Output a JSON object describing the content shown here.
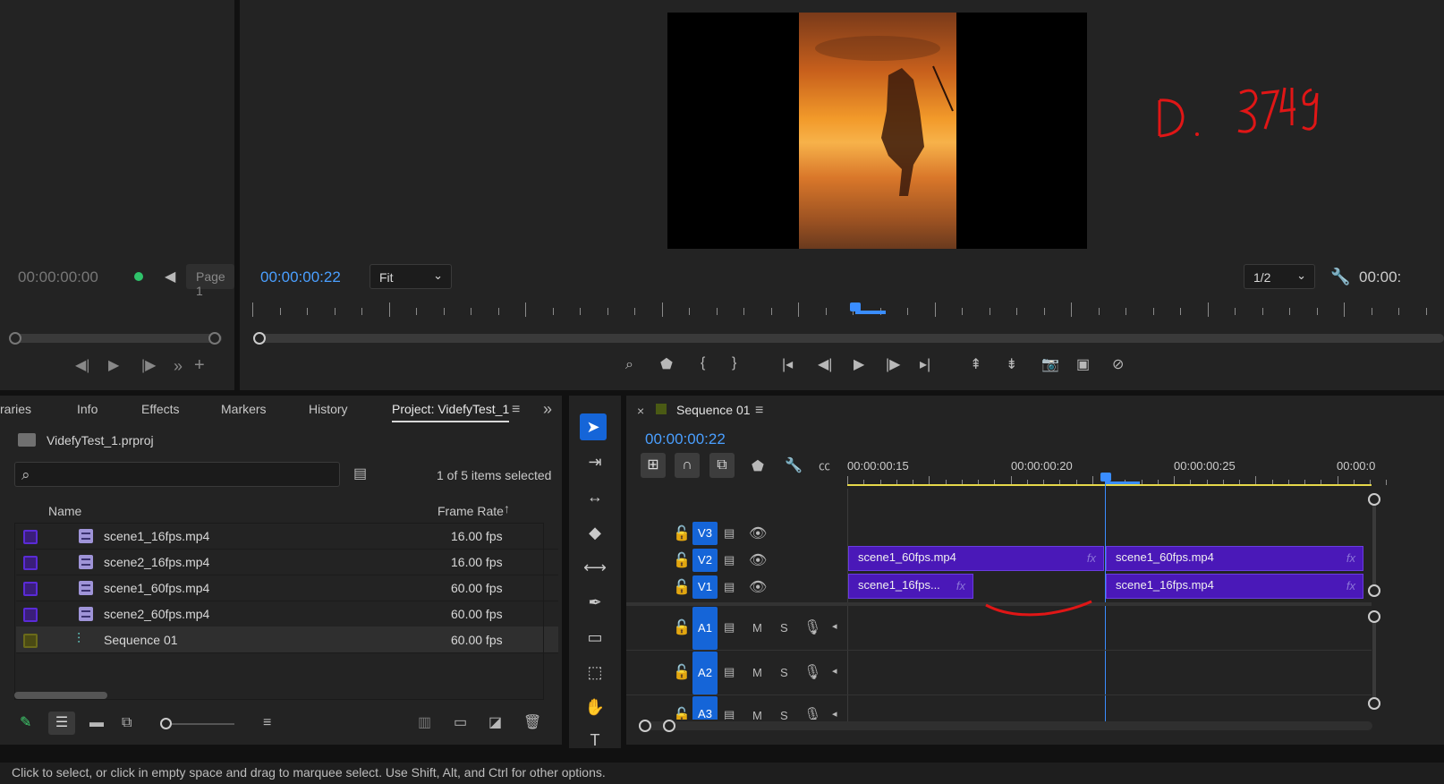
{
  "source_monitor": {
    "timecode": "00:00:00:00",
    "page_label": "Page 1"
  },
  "program_monitor": {
    "timecode": "00:00:00:22",
    "zoom_value": "Fit",
    "resolution_value": "1/2",
    "timecode_right": "00:00:"
  },
  "annotation": {
    "text": "D. 3749",
    "color": "#e01616"
  },
  "project_panel": {
    "tabs": [
      "raries",
      "Info",
      "Effects",
      "Markers",
      "History",
      "Project: VidefyTest_1"
    ],
    "project_file": "VidefyTest_1.prproj",
    "search_placeholder": "",
    "selection_status": "1 of 5 items selected",
    "columns": {
      "name": "Name",
      "frame_rate": "Frame Rate"
    },
    "items": [
      {
        "name": "scene1_16fps.mp4",
        "frame_rate": "16.00 fps",
        "type": "video"
      },
      {
        "name": "scene2_16fps.mp4",
        "frame_rate": "16.00 fps",
        "type": "video"
      },
      {
        "name": "scene1_60fps.mp4",
        "frame_rate": "60.00 fps",
        "type": "video"
      },
      {
        "name": "scene2_60fps.mp4",
        "frame_rate": "60.00 fps",
        "type": "video"
      },
      {
        "name": "Sequence 01",
        "frame_rate": "60.00 fps",
        "type": "sequence"
      }
    ]
  },
  "timeline": {
    "sequence_name": "Sequence 01",
    "timecode": "00:00:00:22",
    "ruler_labels": [
      "00:00:00:15",
      "00:00:00:20",
      "00:00:00:25",
      "00:00:0"
    ],
    "video_tracks": [
      "V3",
      "V2",
      "V1"
    ],
    "audio_tracks": [
      "A1",
      "A2",
      "A3"
    ],
    "mute_label": "M",
    "solo_label": "S",
    "clips": {
      "v2_left": "scene1_60fps.mp4",
      "v2_right": "scene1_60fps.mp4",
      "v1_left": "scene1_16fps...",
      "v1_right": "scene1_16fps.mp4",
      "fx_label": "fx"
    }
  },
  "status_bar": {
    "text": "Click to select, or click in empty space and drag to marquee select. Use Shift, Alt, and Ctrl for other options."
  },
  "colors": {
    "accent_blue": "#4a9fff",
    "clip_purple": "#4a18b8",
    "track_blue": "#1565d8",
    "in_out_yellow": "#e6d84a"
  }
}
